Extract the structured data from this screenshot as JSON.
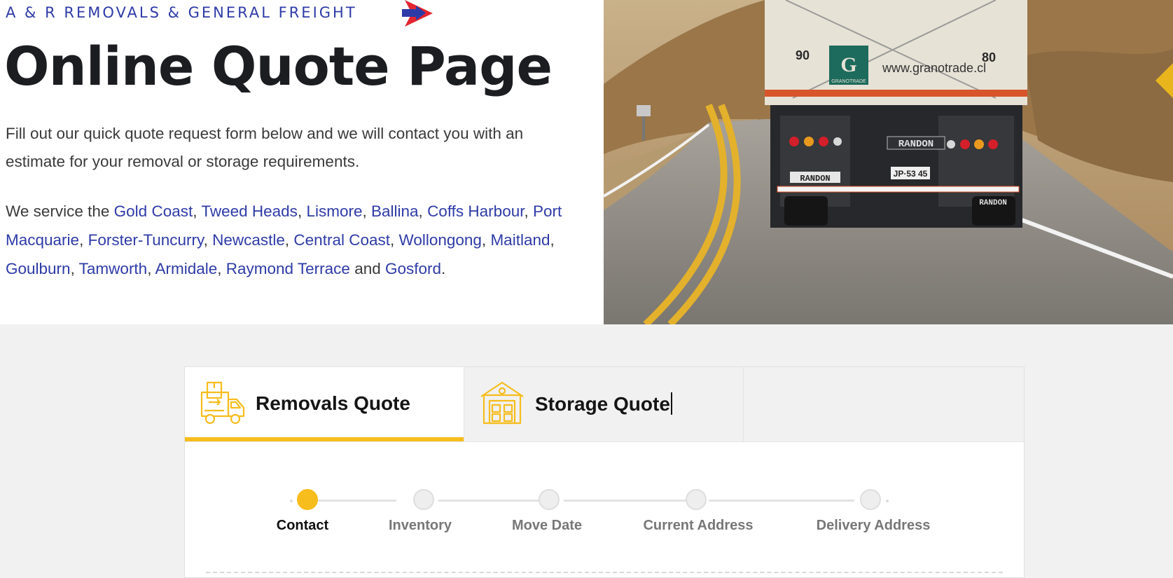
{
  "header": {
    "brand": "A & R REMOVALS & GENERAL FREIGHT",
    "title": "Online Quote Page",
    "intro": "Fill out our quick quote request form below and we will contact you with an estimate for your removal or storage requirements."
  },
  "service_areas": {
    "prefix": "We service the",
    "links": [
      "Gold Coast",
      "Tweed Heads",
      "Lismore",
      "Ballina",
      "Coffs Harbour",
      "Port Macquarie",
      "Forster-Tuncurry",
      "Newcastle",
      "Central Coast",
      "Wollongong",
      "Maitland",
      "Goulburn",
      "Tamworth",
      "Armidale",
      "Raymond Terrace",
      "Gosford"
    ],
    "separator": ", ",
    "conjunction": "and",
    "suffix": "."
  },
  "photo": {
    "truck_left_number": "90",
    "truck_right_number": "80",
    "trailer_text": "www.granotrade.cl",
    "logo_text": "GRANOTRADE",
    "plate_text": "RANDON",
    "license_plate": "JP·53 45"
  },
  "tabs": [
    {
      "label": "Removals Quote",
      "icon": "moving-truck-icon",
      "active": true
    },
    {
      "label": "Storage Quote",
      "icon": "storage-building-icon",
      "active": false
    }
  ],
  "steps": [
    {
      "label": "Contact",
      "active": true
    },
    {
      "label": "Inventory",
      "active": false
    },
    {
      "label": "Move Date",
      "active": false
    },
    {
      "label": "Current Address",
      "active": false
    },
    {
      "label": "Delivery Address",
      "active": false
    }
  ],
  "colors": {
    "accent": "#f6bd1d",
    "brand_blue": "#2e3ba7",
    "logo_red": "#e3262f"
  }
}
